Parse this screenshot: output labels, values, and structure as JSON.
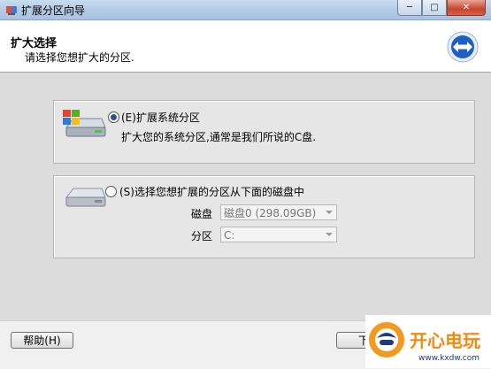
{
  "window": {
    "title": "扩展分区向导",
    "controls": {
      "minimize": "─",
      "maximize": "□",
      "close": "✕"
    }
  },
  "header": {
    "title": "扩大选择",
    "subtitle": "请选择您想扩大的分区."
  },
  "options": [
    {
      "label": "(E)扩展系统分区",
      "description": "扩大您的系统分区,通常是我们所说的C盘.",
      "selected": true
    },
    {
      "label": "(S)选择您想扩展的分区从下面的磁盘中",
      "selected": false,
      "disk_label": "磁盘",
      "disk_value": "磁盘0 (298.09GB)",
      "partition_label": "分区",
      "partition_value": "C:"
    }
  ],
  "footer": {
    "help_label": "帮助(H)",
    "next_label": "下一"
  },
  "watermark": {
    "title": "开心电玩",
    "url": "www.kxdw.com"
  },
  "colors": {
    "accent": "#2a63b8",
    "header_bg": "#ffffff",
    "body_bg": "#dcdcdc"
  }
}
